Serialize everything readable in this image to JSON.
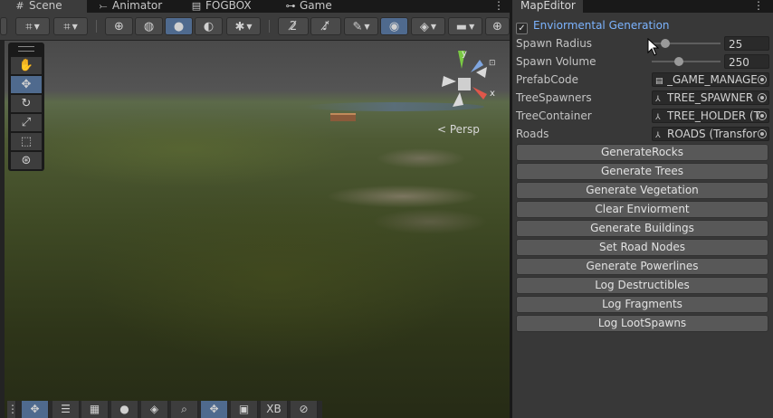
{
  "tabs": [
    {
      "label": "Scene",
      "icon": "grid-icon"
    },
    {
      "label": "Animator",
      "icon": "animator-icon"
    },
    {
      "label": "FOGBOX",
      "icon": "document-icon"
    },
    {
      "label": "Game",
      "icon": "gamepad-icon"
    }
  ],
  "viewport": {
    "projection_label": "< Persp",
    "axis_y": "y",
    "axis_x": "x"
  },
  "bottom_bar": {
    "xb_label": "XB"
  },
  "inspector": {
    "tab_label": "MapEditor",
    "foldout_label": "Enviormental Generation",
    "foldout_checked": "✓",
    "properties": {
      "spawn_radius": {
        "label": "Spawn Radius",
        "value": "25",
        "slider_fraction": 0.2
      },
      "spawn_volume": {
        "label": "Spawn Volume",
        "value": "250",
        "slider_fraction": 0.4
      },
      "prefab_code": {
        "label": "PrefabCode",
        "value": "_GAME_MANAGE"
      },
      "tree_spawners": {
        "label": "TreeSpawners",
        "value": "TREE_SPAWNER"
      },
      "tree_container": {
        "label": "TreeContainer",
        "value": "TREE_HOLDER (T"
      },
      "roads": {
        "label": "Roads",
        "value": "ROADS (Transfor"
      }
    },
    "buttons": [
      "GenerateRocks",
      "Generate Trees",
      "Generate Vegetation",
      "Clear Enviorment",
      "Generate Buildings",
      "Set Road Nodes",
      "Generate Powerlines",
      "Log Destructibles",
      "Log Fragments",
      "Log LootSpawns"
    ]
  },
  "colors": {
    "accent": "#4f6a8e",
    "foldout_text": "#7cb4ff"
  }
}
